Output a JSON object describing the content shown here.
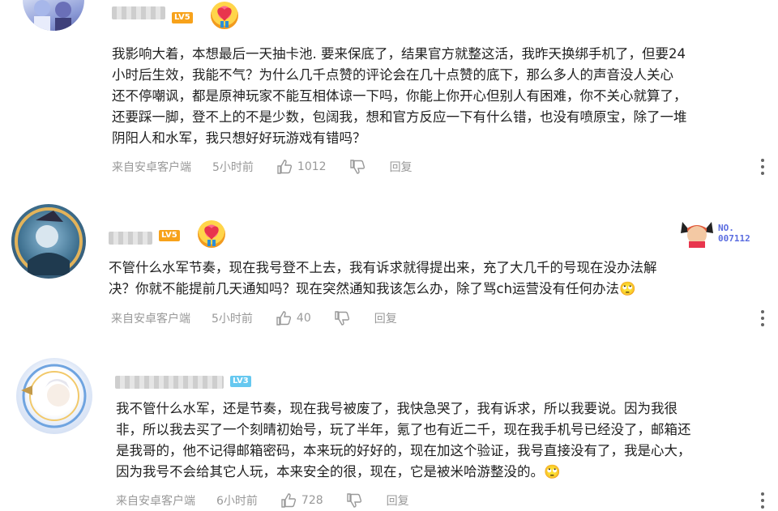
{
  "comments": [
    {
      "level": "LV5",
      "text": "我影响大着，本想最后一天抽卡池. 要来保底了，结果官方就整这活，我昨天换绑手机了，但要24\n小时后生效，我能不气？为什么几千点赞的评论会在几十点赞的底下，那么多人的声音没人关心\n还不停嘲讽，都是原神玩家不能互相体谅一下吗，你能上你开心但别人有困难，你不关心就算了，\n还要踩一脚，登不上的不是少数，包阔我，想和官方反应一下有什么错，也没有喷原宝，除了一堆\n阴阳人和水军，我只想好好玩游戏有错吗？",
      "source": "来自安卓客户端",
      "time": "5小时前",
      "likes": "1012",
      "reply": "回复"
    },
    {
      "level": "LV5",
      "badge_label": "NO.",
      "badge_number": "007112",
      "text": "不管什么水军节奏，现在我号登不上去，我有诉求就得提出来，充了大几千的号现在没办法解\n决？你就不能提前几天通知吗？现在突然通知我该怎么办，除了骂ch运营没有任何办法🙄",
      "source": "来自安卓客户端",
      "time": "5小时前",
      "likes": "40",
      "reply": "回复"
    },
    {
      "level": "LV3",
      "text": "我不管什么水军，还是节奏，现在我号被废了，我快急哭了，我有诉求，所以我要说。因为我很\n非，所以我去买了一个刻晴初始号，玩了半年，氪了也有近二千，现在我手机号已经没了，邮箱还\n是我哥的，他不记得邮箱密码，本来玩的好好的，现在加这个验证，我号直接没有了，我是心大，\n因为我号不会给其它人玩，本来安全的很，现在，它是被米哈游整没的。🙄",
      "source": "来自安卓客户端",
      "time": "6小时前",
      "likes": "728",
      "reply": "回复"
    }
  ],
  "colors": {
    "level_orange": "#f7a21b",
    "level_blue": "#66c8f0",
    "meta_gray": "#999999"
  }
}
